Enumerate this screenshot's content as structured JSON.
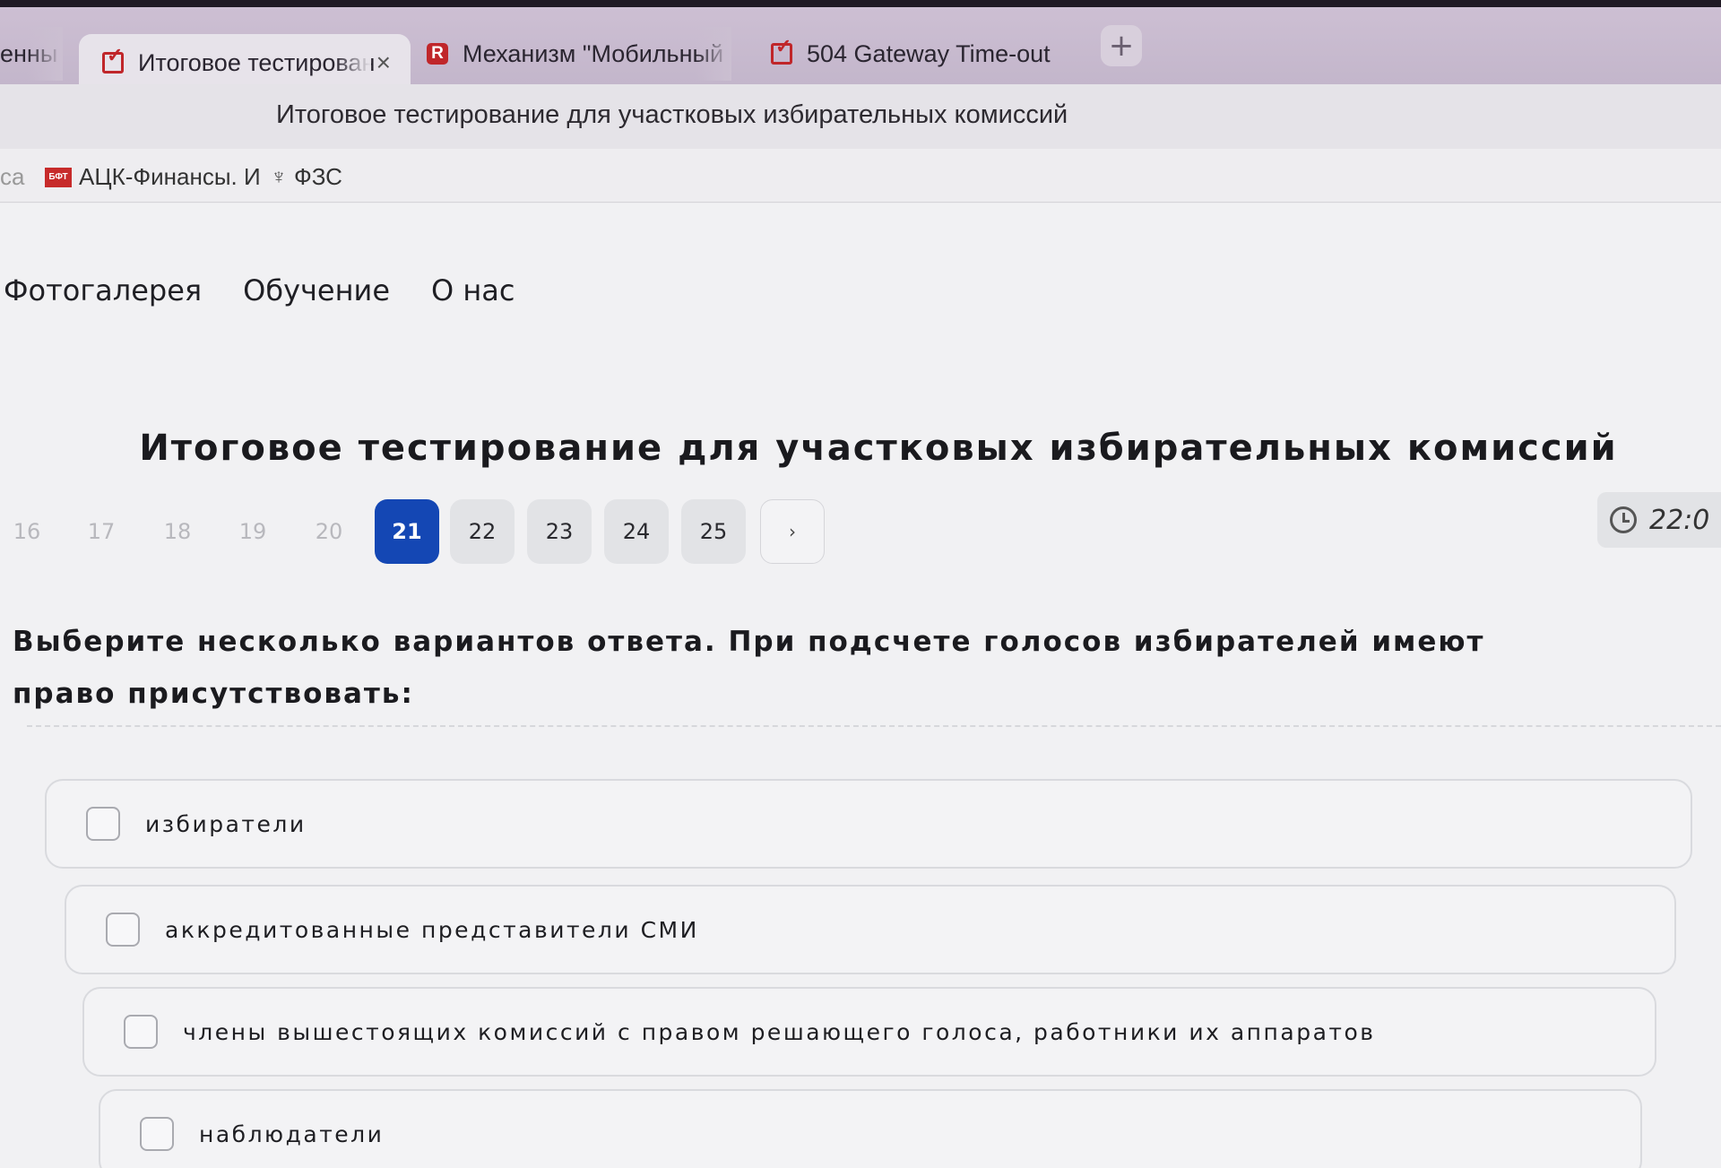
{
  "browser": {
    "tabs": [
      {
        "label": "енны"
      },
      {
        "label": "Итоговое тестирован",
        "active": true
      },
      {
        "label": "Механизм \"Мобильный"
      },
      {
        "label": "504 Gateway Time-out"
      }
    ],
    "close_glyph": "×",
    "new_tab_glyph": "+",
    "page_title": "Итоговое тестирование для участковых избирательных комиссий",
    "bookmarks": [
      {
        "label": "са"
      },
      {
        "label": "АЦК-Финансы. И",
        "icon_text": "БФТ"
      },
      {
        "label": "ФЗС"
      }
    ]
  },
  "site": {
    "nav": [
      "Фотогалерея",
      "Обучение",
      "О нас"
    ]
  },
  "test": {
    "title": "Итоговое тестирование для участковых избирательных комиссий",
    "pager": {
      "pages": [
        "16",
        "17",
        "18",
        "19",
        "20",
        "21",
        "22",
        "23",
        "24",
        "25"
      ],
      "current": "21",
      "next_glyph": "›"
    },
    "timer": "22:0",
    "question": "Выберите несколько вариантов ответа. При подсчете голосов избирателей имеют право присутствовать:",
    "options": [
      {
        "label": "избиратели",
        "checked": false
      },
      {
        "label": "аккредитованные представители СМИ",
        "checked": false
      },
      {
        "label": "члены вышестоящих комиссий с правом решающего голоса, работники их аппаратов",
        "checked": false
      },
      {
        "label": "наблюдатели",
        "checked": false
      }
    ]
  },
  "colors": {
    "accent": "#1447b4",
    "tab_strip": "#c8bbcf"
  }
}
